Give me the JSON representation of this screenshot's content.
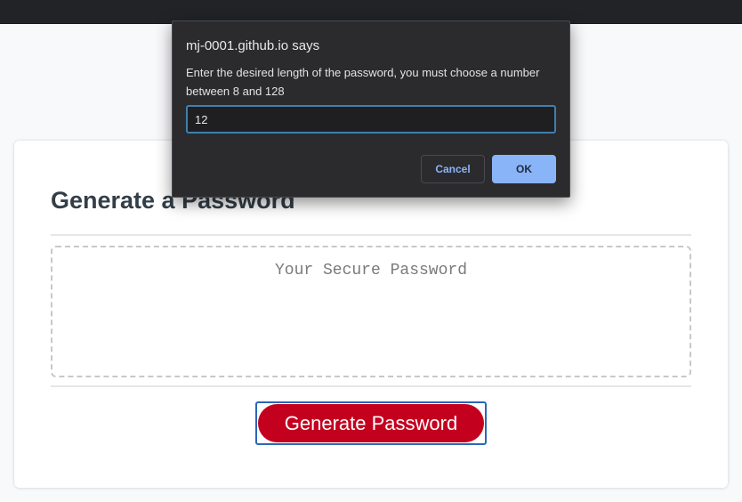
{
  "page": {
    "card_title": "Generate a Password",
    "password_placeholder": "Your Secure Password",
    "generate_button_label": "Generate Password"
  },
  "dialog": {
    "title": "mj-0001.github.io says",
    "message": "Enter the desired length of the password, you must choose a number between 8 and 128",
    "input_value": "12",
    "cancel_label": "Cancel",
    "ok_label": "OK"
  },
  "colors": {
    "generate_button": "#c4001f",
    "ok_button": "#8ab4f8",
    "dialog_background": "#2b2b2e",
    "title_text": "#333e48"
  }
}
